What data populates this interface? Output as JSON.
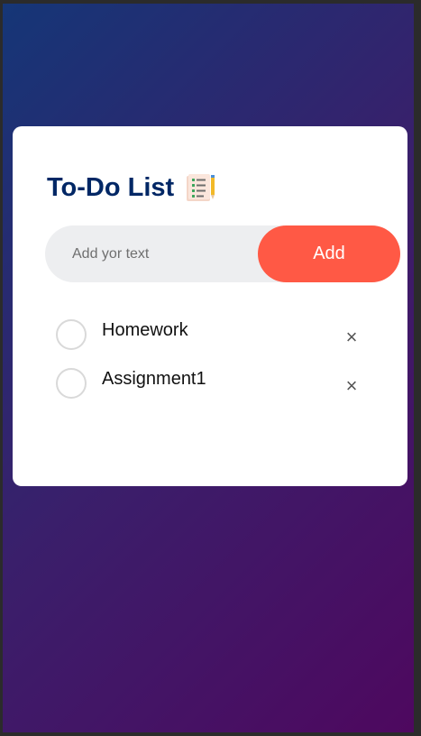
{
  "app": {
    "title": "To-Do List",
    "title_icon": "checklist-notepad-icon"
  },
  "input": {
    "placeholder": "Add yor text",
    "value": ""
  },
  "add_button": {
    "label": "Add"
  },
  "tasks": [
    {
      "label": "Homework",
      "checked": false
    },
    {
      "label": "Assignment1",
      "checked": false
    }
  ],
  "icons": {
    "delete": "×"
  },
  "colors": {
    "title": "#002765",
    "accent": "#ff5945",
    "input_bg": "#edeef0",
    "gradient_start": "#153677",
    "gradient_end": "#4e085f"
  }
}
